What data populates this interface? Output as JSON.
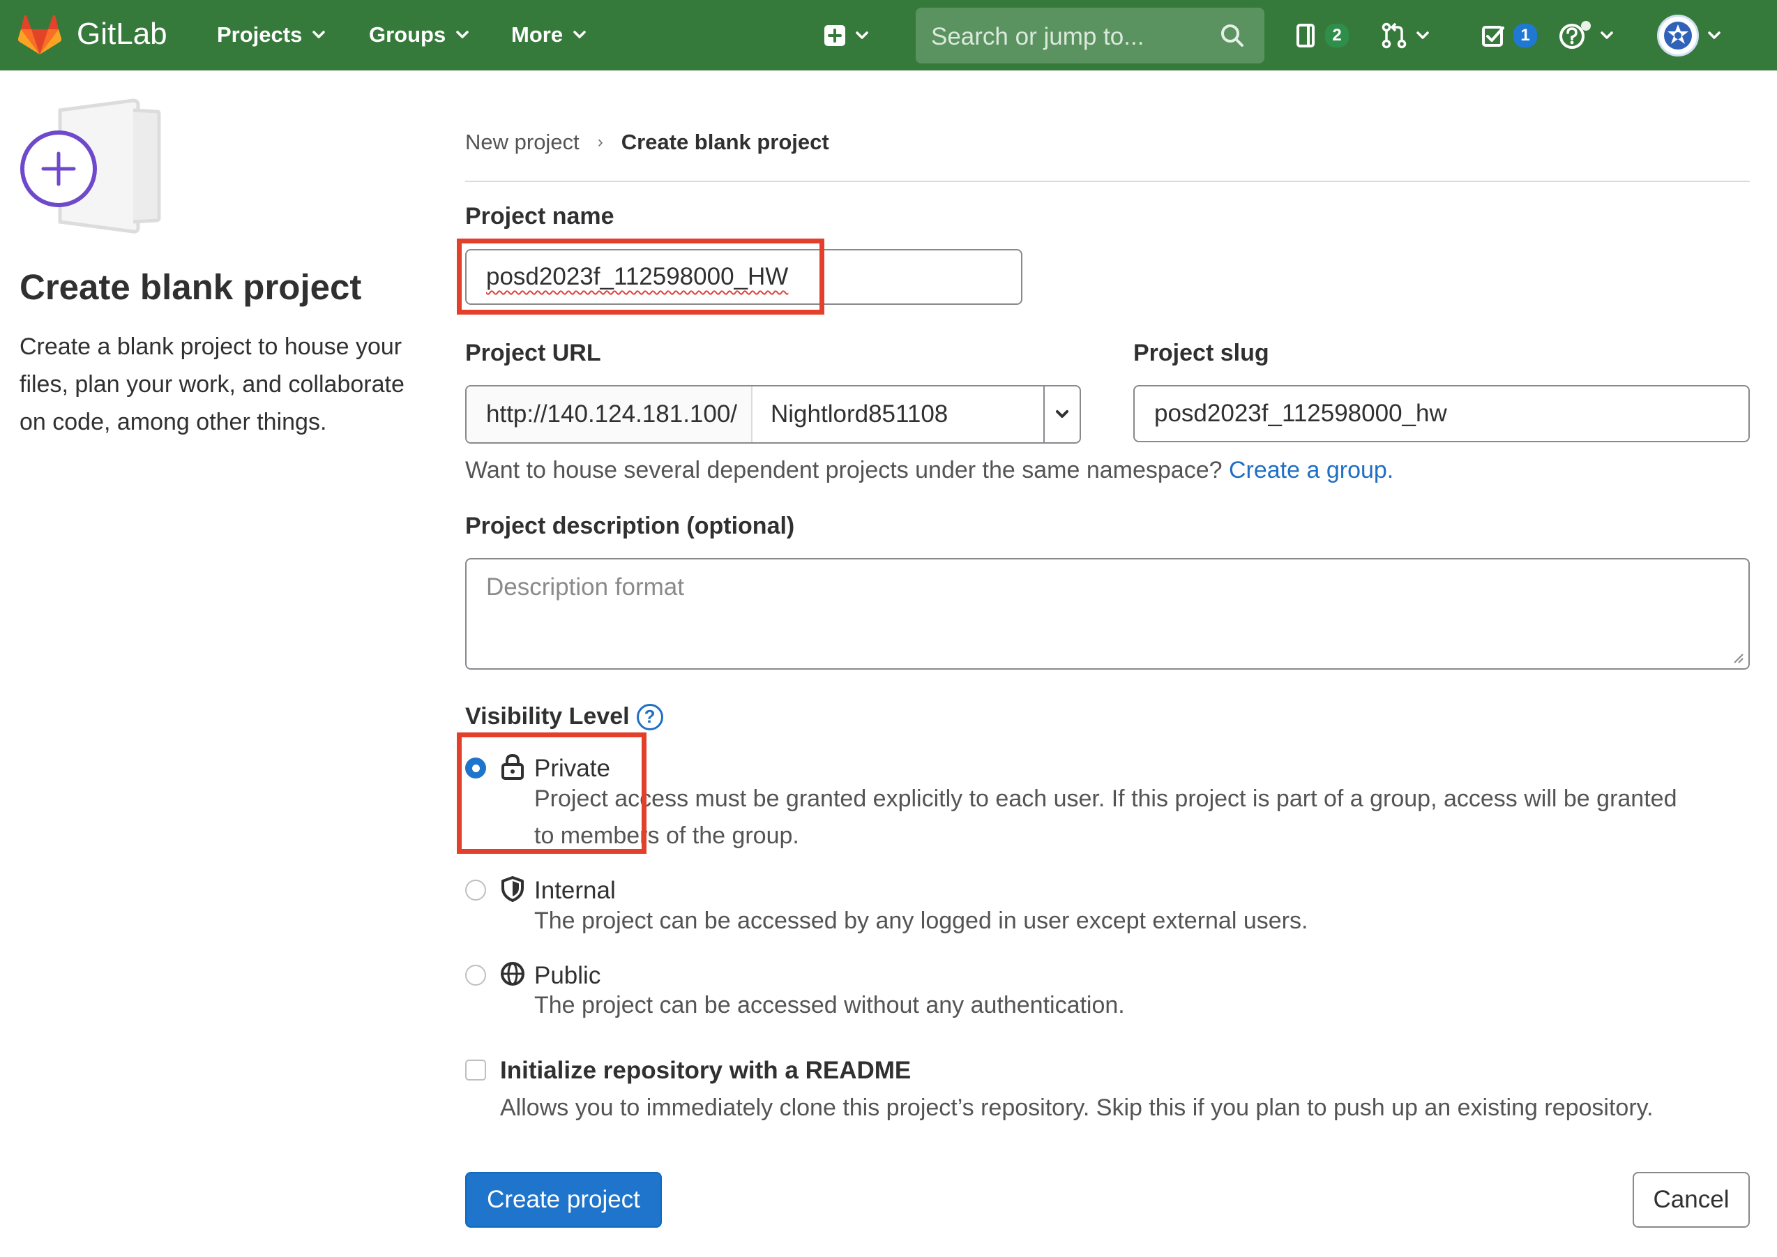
{
  "colors": {
    "nav_bg": "#367a3b",
    "primary": "#1f75cb",
    "link": "#1f6fc5",
    "highlight": "#e2402b"
  },
  "topbar": {
    "brand": "GitLab",
    "nav": {
      "projects": "Projects",
      "groups": "Groups",
      "more": "More"
    },
    "search_placeholder": "Search or jump to...",
    "issues_count": "2",
    "todos_count": "1",
    "icons": [
      "gitlab-logo-icon",
      "new-item-icon",
      "search-icon",
      "issues-icon",
      "merge-request-icon",
      "todo-icon",
      "help-icon",
      "user-avatar"
    ]
  },
  "sidebar": {
    "title": "Create blank project",
    "description": "Create a blank project to house your files, plan your work, and collaborate on code, among other things."
  },
  "breadcrumb": {
    "parent": "New project",
    "separator": "›",
    "current": "Create blank project"
  },
  "form": {
    "project_name": {
      "label": "Project name",
      "value": "posd2023f_112598000_HW"
    },
    "project_url": {
      "label": "Project URL",
      "prefix": "http://140.124.181.100/",
      "namespace": "Nightlord851108"
    },
    "project_slug": {
      "label": "Project slug",
      "value": "posd2023f_112598000_hw"
    },
    "group_help": {
      "text": "Want to house several dependent projects under the same namespace?",
      "link": "Create a group."
    },
    "description": {
      "label": "Project description (optional)",
      "placeholder": "Description format"
    },
    "visibility": {
      "label": "Visibility Level",
      "help_glyph": "?",
      "selected": "Private",
      "options": [
        {
          "title": "Private",
          "icon": "lock-icon",
          "desc_line1": "Project access must be granted explicitly to each user. If this project is part of a group, access will be granted",
          "desc_line2": "to members of the group."
        },
        {
          "title": "Internal",
          "icon": "shield-icon",
          "desc_line1": "The project can be accessed by any logged in user except external users."
        },
        {
          "title": "Public",
          "icon": "globe-icon",
          "desc_line1": "The project can be accessed without any authentication."
        }
      ]
    },
    "readme": {
      "label": "Initialize repository with a README",
      "checked": false,
      "help": "Allows you to immediately clone this project’s repository. Skip this if you plan to push up an existing repository."
    },
    "submit_label": "Create project",
    "cancel_label": "Cancel"
  }
}
